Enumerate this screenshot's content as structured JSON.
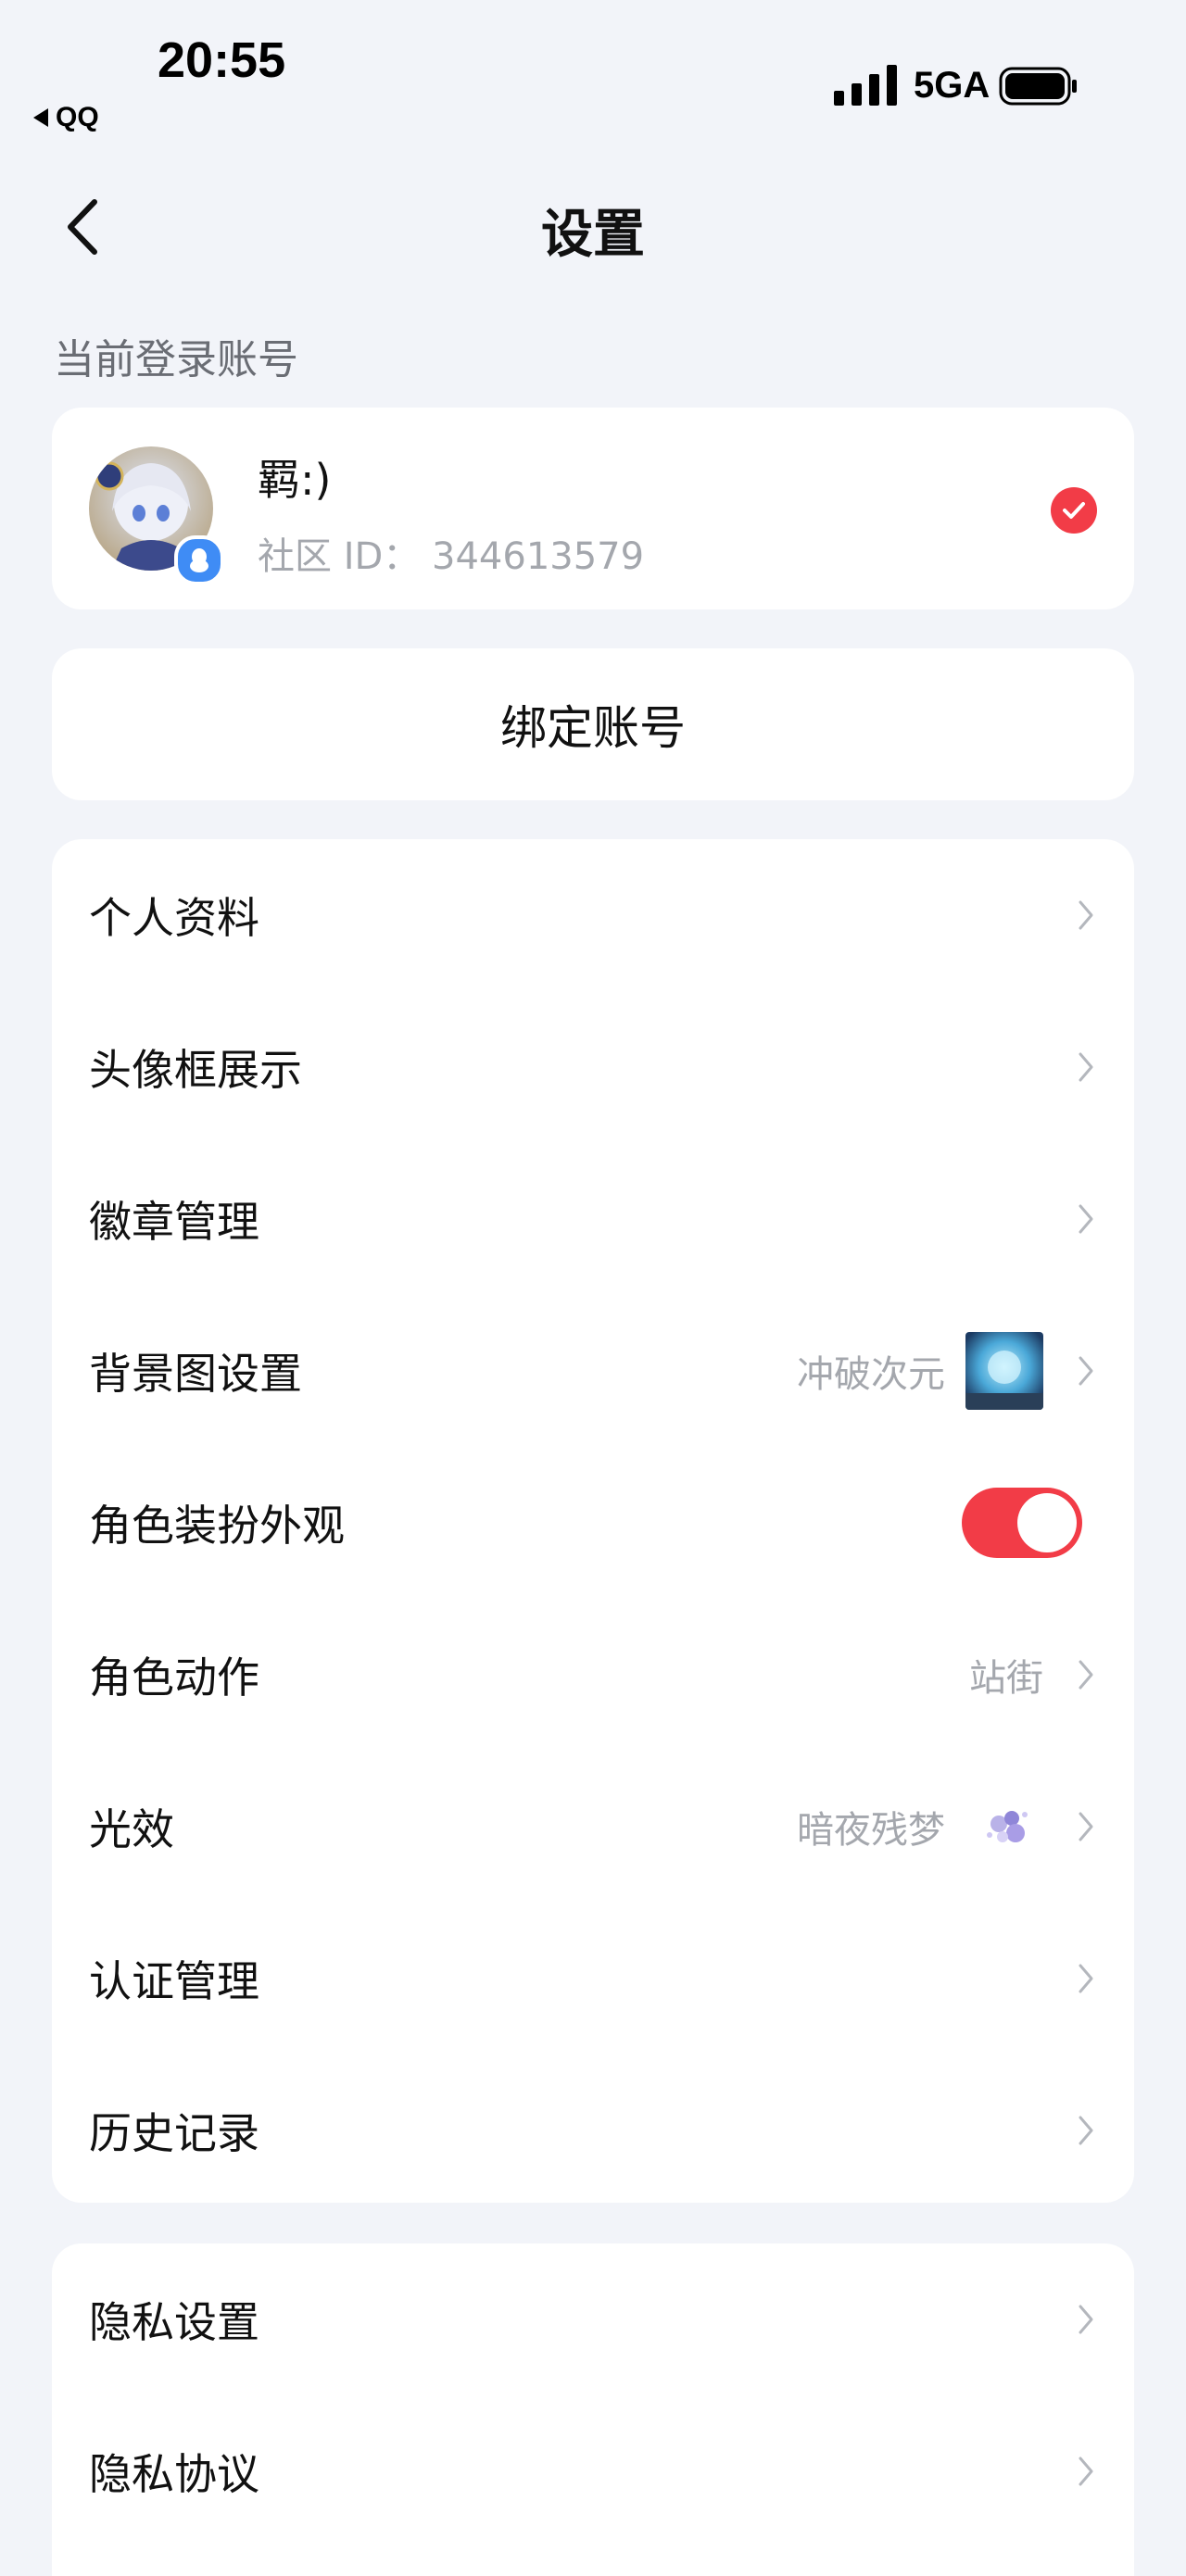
{
  "status_bar": {
    "time": "20:55",
    "back_app": "QQ",
    "network": "5GA"
  },
  "nav": {
    "title": "设置"
  },
  "account": {
    "section_label": "当前登录账号",
    "name": "羁:)",
    "id_text": "社区 ID：  344613579"
  },
  "bind": {
    "label": "绑定账号"
  },
  "menu_group_1": {
    "items": [
      {
        "label": "个人资料"
      },
      {
        "label": "头像框展示"
      },
      {
        "label": "徽章管理"
      },
      {
        "label": "背景图设置",
        "value": "冲破次元"
      },
      {
        "label": "角色装扮外观",
        "toggle_on": true
      },
      {
        "label": "角色动作",
        "value": "站街"
      },
      {
        "label": "光效",
        "value": "暗夜残梦"
      },
      {
        "label": "认证管理"
      },
      {
        "label": "历史记录"
      }
    ]
  },
  "menu_group_2": {
    "items": [
      {
        "label": "隐私设置"
      },
      {
        "label": "隐私协议"
      }
    ]
  },
  "colors": {
    "accent": "#f23c47",
    "background": "#f2f4f9",
    "secondary_text": "#a4a7ad"
  }
}
